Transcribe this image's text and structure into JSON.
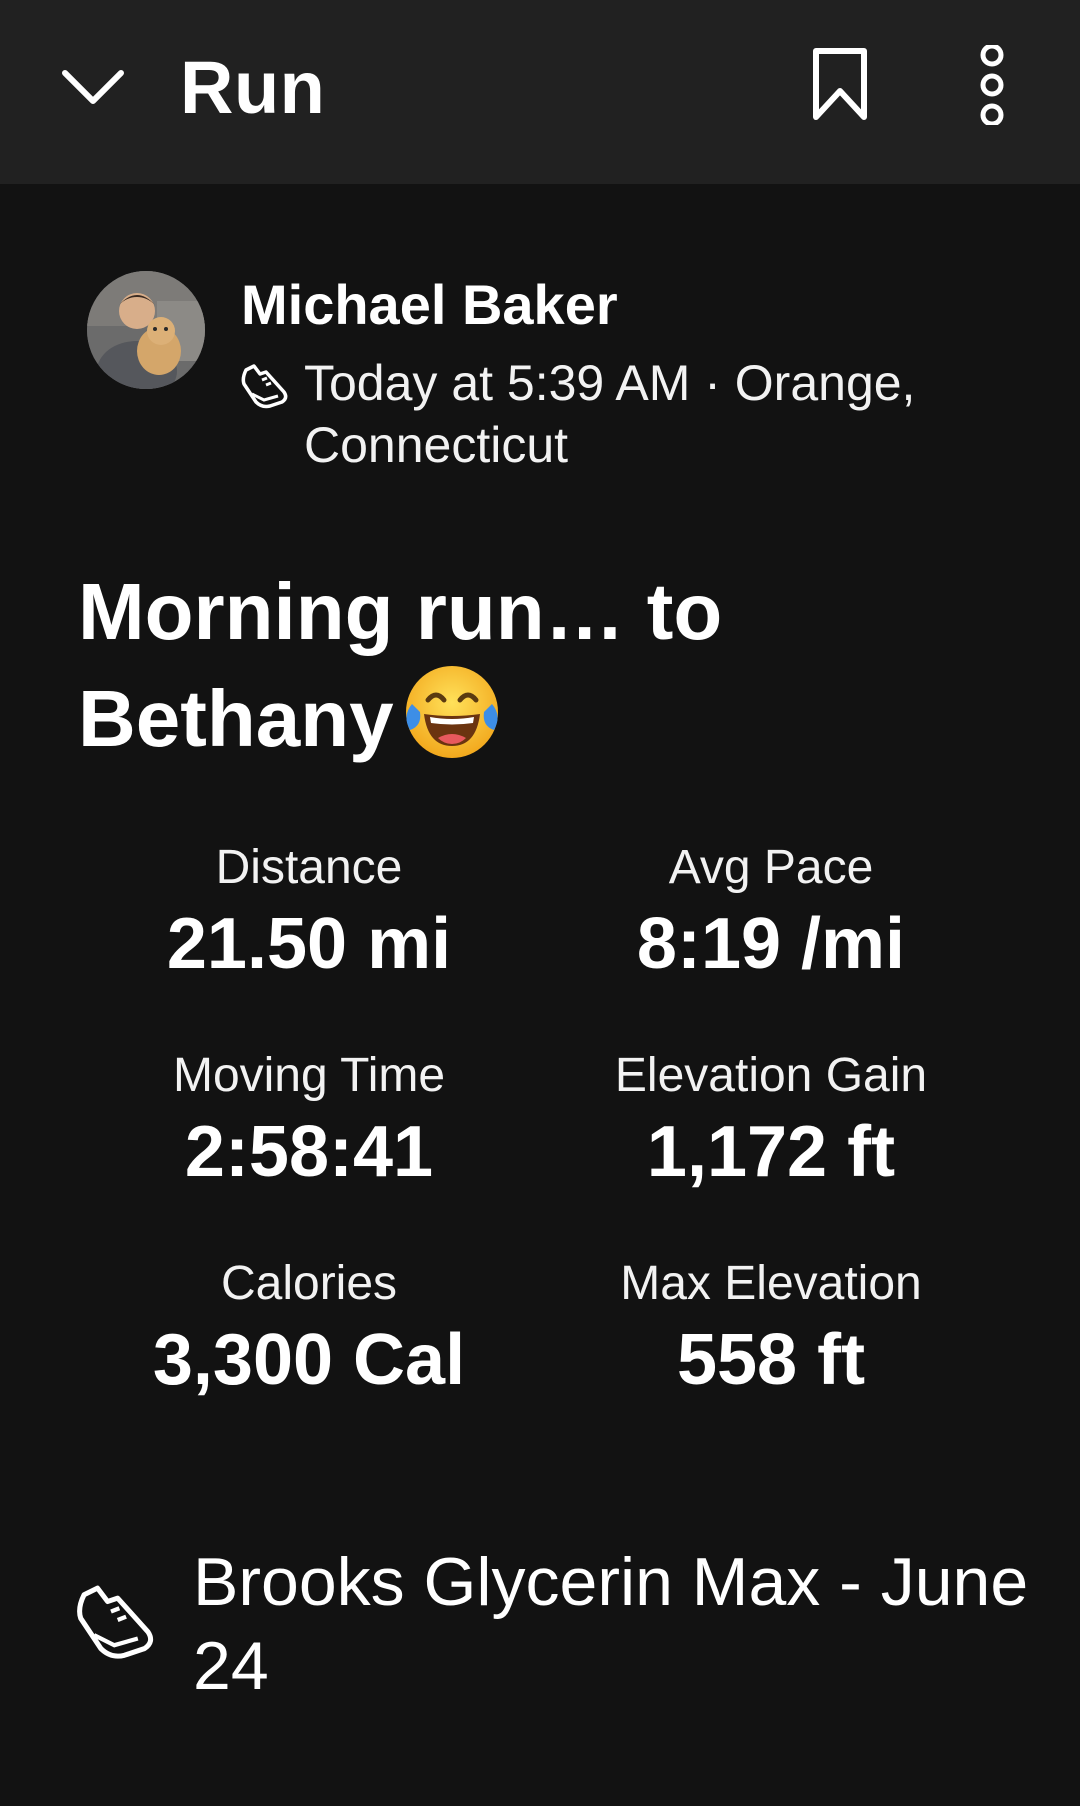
{
  "header": {
    "title": "Run",
    "back_icon": "chevron-down-icon",
    "bookmark_icon": "bookmark-icon",
    "more_icon": "vertical-ellipsis-icon"
  },
  "athlete": {
    "name": "Michael Baker",
    "avatar": "profile-photo",
    "sport_icon": "running-shoe-icon",
    "meta_line1": "Today at 5:39 AM · Orange,",
    "meta_line2": "Connecticut"
  },
  "activity": {
    "title": "Morning run… to Bethany",
    "emoji": "face-with-tears-of-joy"
  },
  "stats": [
    {
      "label": "Distance",
      "value": "21.50 mi"
    },
    {
      "label": "Avg Pace",
      "value": "8:19 /mi"
    },
    {
      "label": "Moving Time",
      "value": "2:58:41"
    },
    {
      "label": "Elevation Gain",
      "value": "1,172 ft"
    },
    {
      "label": "Calories",
      "value": "3,300 Cal"
    },
    {
      "label": "Max Elevation",
      "value": "558 ft"
    }
  ],
  "gear": {
    "icon": "running-shoe-icon",
    "name": "Brooks Glycerin Max - June 24"
  },
  "colors": {
    "background": "#121212",
    "header_background": "#212121",
    "text": "#ffffff",
    "emoji_yellow": "#f7c33b",
    "emoji_tear": "#3d8ee6"
  }
}
